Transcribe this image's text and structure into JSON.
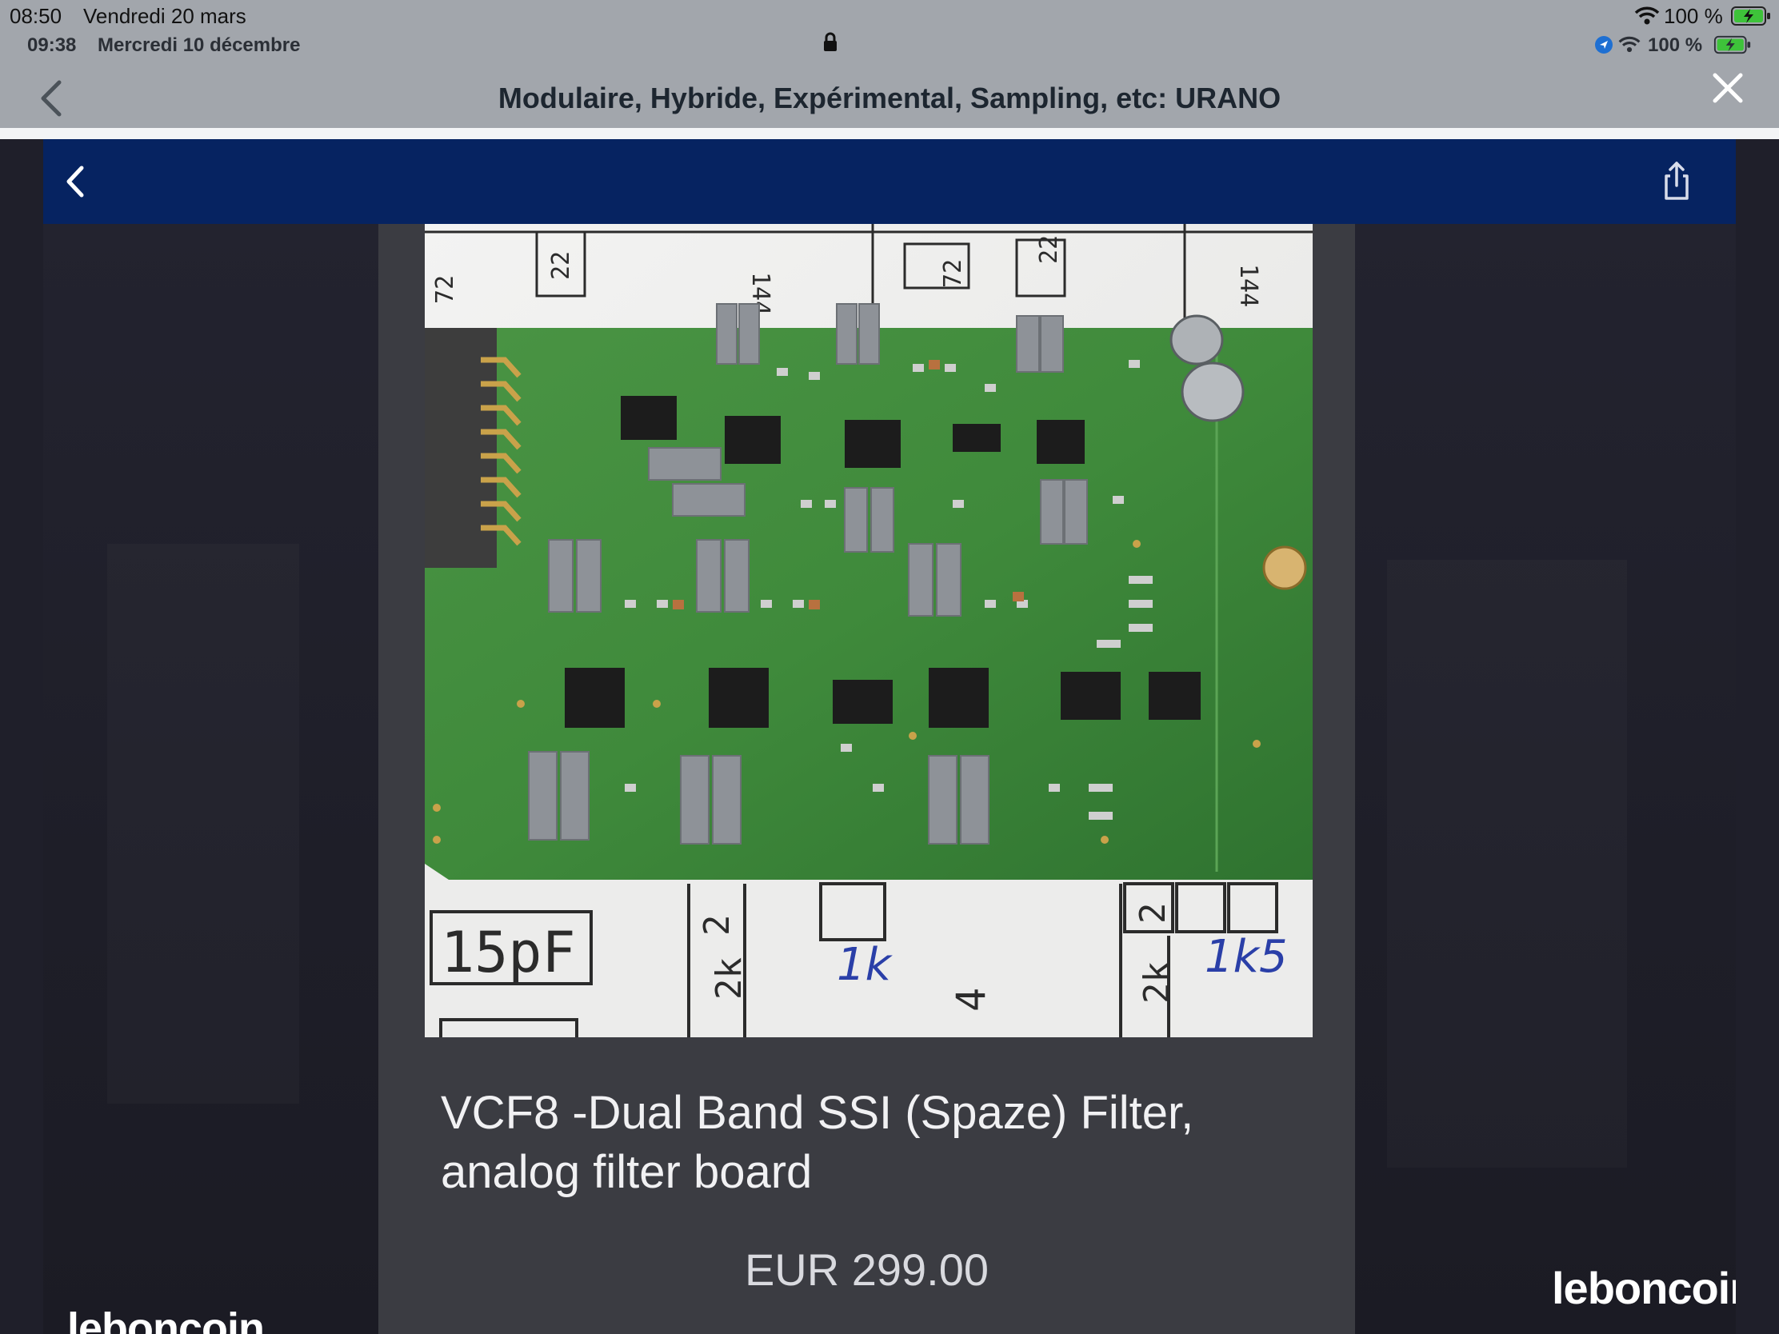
{
  "outer_status": {
    "time": "08:50",
    "date": "Vendredi 20 mars",
    "battery": "100 %"
  },
  "inner_status": {
    "time": "09:38",
    "date": "Mercredi 10 décembre",
    "battery": "100 %"
  },
  "outer_nav": {
    "title": "Modulaire, Hybride, Expérimental, Sampling, etc: URANO"
  },
  "listing": {
    "title_line1": "VCF8 -Dual Band SSI (Spaze) Filter,",
    "title_line2": "analog filter board",
    "price": "EUR 299.00"
  },
  "brand": {
    "watermark": "leboncoin"
  },
  "schematic_labels": {
    "cap": "15pF",
    "r1": "1k",
    "r2": "1k5",
    "n4": "4",
    "n2": "2",
    "n2k": "2k",
    "n22": "22",
    "n72": "72",
    "n144": "144"
  },
  "colors": {
    "outer_bar": "#a2a6ac",
    "inner_nav": "#062361",
    "card_bg": "#3b3c42",
    "pcb_green": "#3f8a3b",
    "battery_green": "#3ec33a"
  }
}
